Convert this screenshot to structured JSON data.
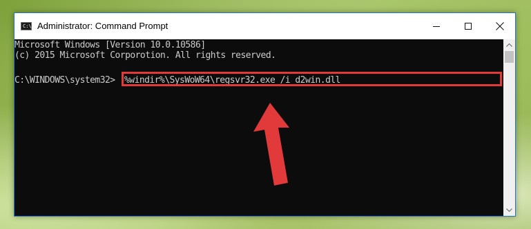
{
  "window": {
    "title": "Administrator: Command Prompt",
    "app_icon_glyph": "C:\\",
    "icon_names": {
      "app": "command-prompt-icon",
      "minimize": "minimize-icon",
      "maximize": "maximize-icon",
      "close": "close-icon",
      "scroll_up": "chevron-up-icon",
      "scroll_down": "chevron-down-icon"
    }
  },
  "console": {
    "line_1": "Microsoft Windows [Version 10.0.10586]",
    "line_2": "(c) 2015 Microsoft Corporotion. All rights reserved.",
    "prompt": "C:\\WINDOWS\\system32>",
    "command": "%windir%\\SysWoW64\\regsvr32.exe /i d2win.dll"
  },
  "colors": {
    "console_background": "#0c0c0c",
    "console_text": "#cccccc",
    "highlight_border": "#e23a3a",
    "arrow": "#e23a3a",
    "window_border": "#1f75c7"
  }
}
